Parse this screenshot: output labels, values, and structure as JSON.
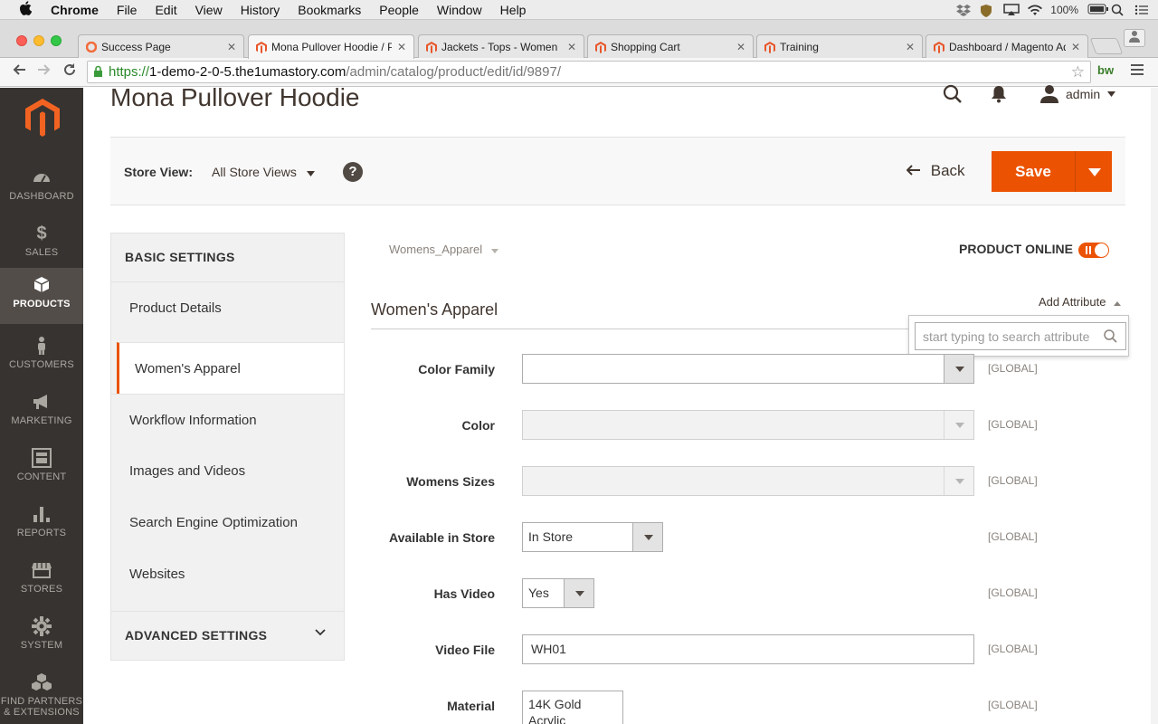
{
  "menubar": {
    "app": "Chrome",
    "items": [
      "File",
      "Edit",
      "View",
      "History",
      "Bookmarks",
      "People",
      "Window",
      "Help"
    ],
    "battery": "100%"
  },
  "tabs": [
    {
      "title": "Success Page",
      "active": false
    },
    {
      "title": "Mona Pullover Hoodie / Pr",
      "active": true
    },
    {
      "title": "Jackets - Tops - Women",
      "active": false
    },
    {
      "title": "Shopping Cart",
      "active": false
    },
    {
      "title": "Training",
      "active": false
    },
    {
      "title": "Dashboard / Magento Adr",
      "active": false
    }
  ],
  "url": {
    "scheme": "https://",
    "host": "1-demo-2-0-5.the1umastory.com",
    "path": "/admin/catalog/product/edit/id/9897/"
  },
  "extension_label": "bw",
  "nav": [
    {
      "label": "DASHBOARD",
      "icon": "dashboard-icon",
      "active": false
    },
    {
      "label": "SALES",
      "icon": "dollar-icon",
      "active": false
    },
    {
      "label": "PRODUCTS",
      "icon": "box-icon",
      "active": true
    },
    {
      "label": "CUSTOMERS",
      "icon": "person-icon",
      "active": false
    },
    {
      "label": "MARKETING",
      "icon": "megaphone-icon",
      "active": false
    },
    {
      "label": "CONTENT",
      "icon": "layout-icon",
      "active": false
    },
    {
      "label": "REPORTS",
      "icon": "bar-chart-icon",
      "active": false
    },
    {
      "label": "STORES",
      "icon": "store-icon",
      "active": false
    },
    {
      "label": "SYSTEM",
      "icon": "gear-icon",
      "active": false
    },
    {
      "label": "FIND PARTNERS",
      "label2": "& EXTENSIONS",
      "icon": "cubes-icon",
      "active": false
    }
  ],
  "page": {
    "title": "Mona Pullover Hoodie",
    "user": "admin"
  },
  "actions": {
    "store_view_label": "Store View:",
    "store_view_value": "All Store Views",
    "back": "Back",
    "save": "Save"
  },
  "settings": {
    "basic_header": "BASIC SETTINGS",
    "items": [
      "Product Details",
      "Women's Apparel",
      "Workflow Information",
      "Images and Videos",
      "Search Engine Optimization",
      "Websites"
    ],
    "active_index": 1,
    "advanced_header": "ADVANCED SETTINGS"
  },
  "content": {
    "attribute_set": "Womens_Apparel",
    "product_online_label": "PRODUCT ONLINE",
    "product_online": true,
    "add_attribute": "Add Attribute",
    "attribute_search_placeholder": "start typing to search attribute",
    "section_title": "Women's Apparel",
    "scope": "[GLOBAL]",
    "fields": {
      "color_family": {
        "label": "Color Family",
        "value": ""
      },
      "color": {
        "label": "Color",
        "value": ""
      },
      "womens_sizes": {
        "label": "Womens Sizes",
        "value": ""
      },
      "available_in_store": {
        "label": "Available in Store",
        "value": "In Store"
      },
      "has_video": {
        "label": "Has Video",
        "value": "Yes"
      },
      "video_file": {
        "label": "Video File",
        "value": "WH01"
      },
      "material": {
        "label": "Material",
        "options": [
          "14K Gold",
          "Acrylic"
        ]
      }
    }
  },
  "colors": {
    "accent": "#eb5202",
    "sidebar_bg": "#373330"
  }
}
